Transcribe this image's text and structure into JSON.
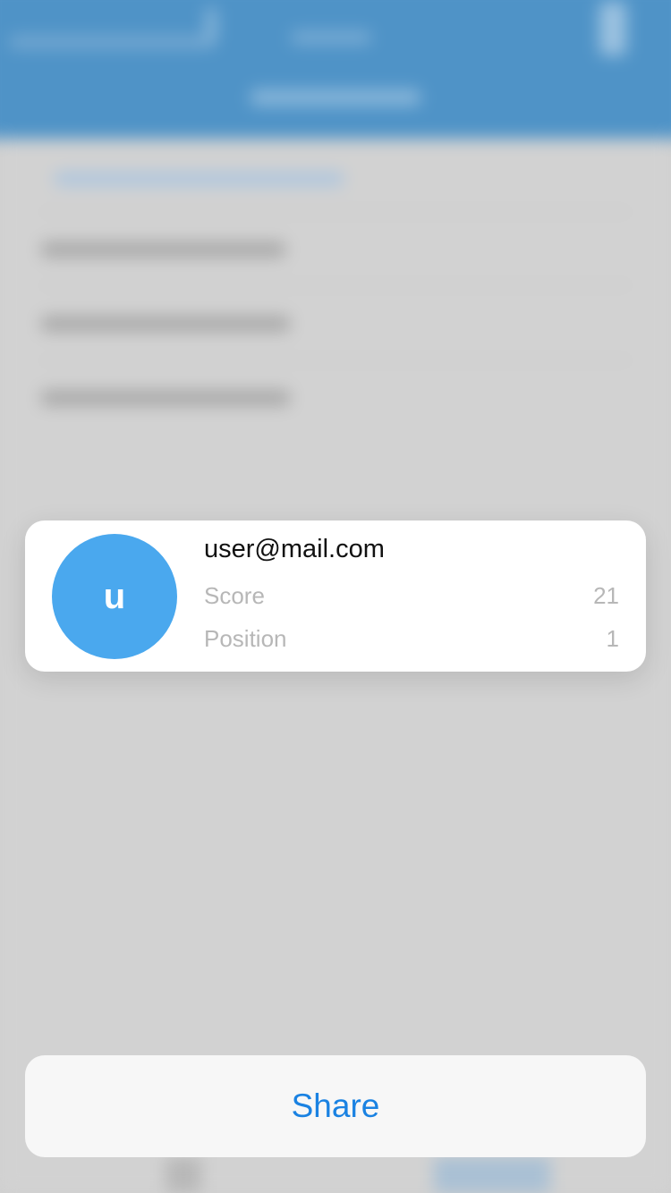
{
  "card": {
    "avatar_initial": "u",
    "email": "user@mail.com",
    "stats": [
      {
        "label": "Score",
        "value": "21"
      },
      {
        "label": "Position",
        "value": "1"
      }
    ]
  },
  "actions": {
    "share_label": "Share"
  },
  "colors": {
    "avatar": "#4aa8ee",
    "accent": "#1a82e2",
    "header": "#4f93c7"
  }
}
